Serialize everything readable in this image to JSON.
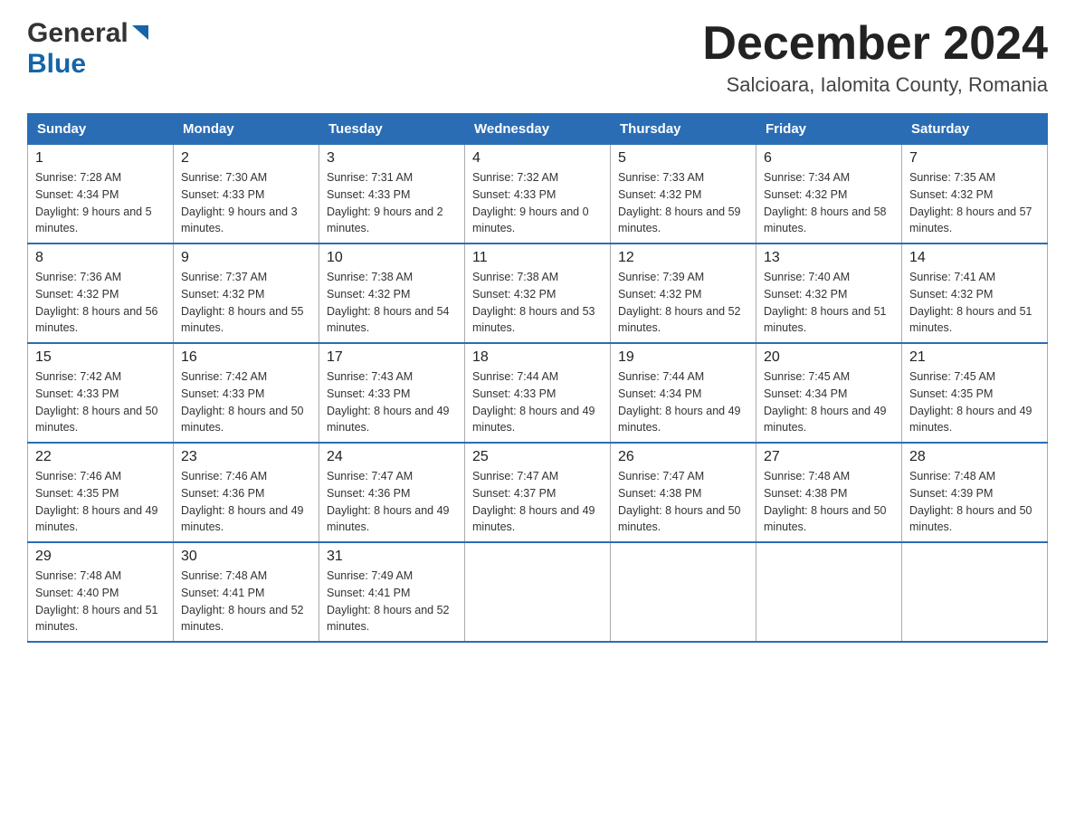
{
  "header": {
    "logo_general": "General",
    "logo_blue": "Blue",
    "main_title": "December 2024",
    "subtitle": "Salcioara, Ialomita County, Romania"
  },
  "weekdays": [
    "Sunday",
    "Monday",
    "Tuesday",
    "Wednesday",
    "Thursday",
    "Friday",
    "Saturday"
  ],
  "weeks": [
    [
      {
        "day": "1",
        "sunrise": "7:28 AM",
        "sunset": "4:34 PM",
        "daylight": "9 hours and 5 minutes."
      },
      {
        "day": "2",
        "sunrise": "7:30 AM",
        "sunset": "4:33 PM",
        "daylight": "9 hours and 3 minutes."
      },
      {
        "day": "3",
        "sunrise": "7:31 AM",
        "sunset": "4:33 PM",
        "daylight": "9 hours and 2 minutes."
      },
      {
        "day": "4",
        "sunrise": "7:32 AM",
        "sunset": "4:33 PM",
        "daylight": "9 hours and 0 minutes."
      },
      {
        "day": "5",
        "sunrise": "7:33 AM",
        "sunset": "4:32 PM",
        "daylight": "8 hours and 59 minutes."
      },
      {
        "day": "6",
        "sunrise": "7:34 AM",
        "sunset": "4:32 PM",
        "daylight": "8 hours and 58 minutes."
      },
      {
        "day": "7",
        "sunrise": "7:35 AM",
        "sunset": "4:32 PM",
        "daylight": "8 hours and 57 minutes."
      }
    ],
    [
      {
        "day": "8",
        "sunrise": "7:36 AM",
        "sunset": "4:32 PM",
        "daylight": "8 hours and 56 minutes."
      },
      {
        "day": "9",
        "sunrise": "7:37 AM",
        "sunset": "4:32 PM",
        "daylight": "8 hours and 55 minutes."
      },
      {
        "day": "10",
        "sunrise": "7:38 AM",
        "sunset": "4:32 PM",
        "daylight": "8 hours and 54 minutes."
      },
      {
        "day": "11",
        "sunrise": "7:38 AM",
        "sunset": "4:32 PM",
        "daylight": "8 hours and 53 minutes."
      },
      {
        "day": "12",
        "sunrise": "7:39 AM",
        "sunset": "4:32 PM",
        "daylight": "8 hours and 52 minutes."
      },
      {
        "day": "13",
        "sunrise": "7:40 AM",
        "sunset": "4:32 PM",
        "daylight": "8 hours and 51 minutes."
      },
      {
        "day": "14",
        "sunrise": "7:41 AM",
        "sunset": "4:32 PM",
        "daylight": "8 hours and 51 minutes."
      }
    ],
    [
      {
        "day": "15",
        "sunrise": "7:42 AM",
        "sunset": "4:33 PM",
        "daylight": "8 hours and 50 minutes."
      },
      {
        "day": "16",
        "sunrise": "7:42 AM",
        "sunset": "4:33 PM",
        "daylight": "8 hours and 50 minutes."
      },
      {
        "day": "17",
        "sunrise": "7:43 AM",
        "sunset": "4:33 PM",
        "daylight": "8 hours and 49 minutes."
      },
      {
        "day": "18",
        "sunrise": "7:44 AM",
        "sunset": "4:33 PM",
        "daylight": "8 hours and 49 minutes."
      },
      {
        "day": "19",
        "sunrise": "7:44 AM",
        "sunset": "4:34 PM",
        "daylight": "8 hours and 49 minutes."
      },
      {
        "day": "20",
        "sunrise": "7:45 AM",
        "sunset": "4:34 PM",
        "daylight": "8 hours and 49 minutes."
      },
      {
        "day": "21",
        "sunrise": "7:45 AM",
        "sunset": "4:35 PM",
        "daylight": "8 hours and 49 minutes."
      }
    ],
    [
      {
        "day": "22",
        "sunrise": "7:46 AM",
        "sunset": "4:35 PM",
        "daylight": "8 hours and 49 minutes."
      },
      {
        "day": "23",
        "sunrise": "7:46 AM",
        "sunset": "4:36 PM",
        "daylight": "8 hours and 49 minutes."
      },
      {
        "day": "24",
        "sunrise": "7:47 AM",
        "sunset": "4:36 PM",
        "daylight": "8 hours and 49 minutes."
      },
      {
        "day": "25",
        "sunrise": "7:47 AM",
        "sunset": "4:37 PM",
        "daylight": "8 hours and 49 minutes."
      },
      {
        "day": "26",
        "sunrise": "7:47 AM",
        "sunset": "4:38 PM",
        "daylight": "8 hours and 50 minutes."
      },
      {
        "day": "27",
        "sunrise": "7:48 AM",
        "sunset": "4:38 PM",
        "daylight": "8 hours and 50 minutes."
      },
      {
        "day": "28",
        "sunrise": "7:48 AM",
        "sunset": "4:39 PM",
        "daylight": "8 hours and 50 minutes."
      }
    ],
    [
      {
        "day": "29",
        "sunrise": "7:48 AM",
        "sunset": "4:40 PM",
        "daylight": "8 hours and 51 minutes."
      },
      {
        "day": "30",
        "sunrise": "7:48 AM",
        "sunset": "4:41 PM",
        "daylight": "8 hours and 52 minutes."
      },
      {
        "day": "31",
        "sunrise": "7:49 AM",
        "sunset": "4:41 PM",
        "daylight": "8 hours and 52 minutes."
      },
      null,
      null,
      null,
      null
    ]
  ]
}
